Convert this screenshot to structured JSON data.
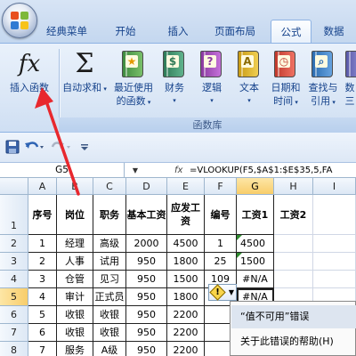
{
  "ribbon": {
    "tabs": [
      {
        "label": "经典菜单",
        "active": false
      },
      {
        "label": "开始",
        "active": false
      },
      {
        "label": "插入",
        "active": false
      },
      {
        "label": "页面布局",
        "active": false
      },
      {
        "label": "公式",
        "active": true
      },
      {
        "label": "数据",
        "active": false
      }
    ],
    "buttons": {
      "insert_function": "插入函数",
      "autosum_line1": "自动求和",
      "recent_line1": "最近使用",
      "recent_line2": "的函数",
      "financial": "财务",
      "logical": "逻辑",
      "text": "文本",
      "datetime_line1": "日期和",
      "datetime_line2": "时间",
      "lookup_line1": "查找与",
      "lookup_line2": "引用",
      "math_line1": "数",
      "math_line2": "三"
    },
    "group_label": "函数库",
    "fx_symbol": "fx",
    "sigma_symbol": "Σ"
  },
  "formula_bar": {
    "name_box": "G5",
    "fx_label": "fx",
    "formula": "=VLOOKUP(F5,$A$1:$E$35,5,FA"
  },
  "sheet": {
    "columns": [
      "A",
      "B",
      "C",
      "D",
      "E",
      "F",
      "G",
      "H",
      "I"
    ],
    "rows": [
      "1",
      "2",
      "3",
      "4",
      "5",
      "6",
      "7",
      "8"
    ],
    "headers": {
      "A": "序号",
      "B": "岗位",
      "C": "职务",
      "D": "基本工资",
      "E": "应发工资",
      "F": "编号",
      "G": "工资1",
      "H": "工资2"
    },
    "data": [
      {
        "A": "1",
        "B": "经理",
        "C": "高级",
        "D": "2000",
        "E": "4500",
        "F": "1",
        "G": "4500"
      },
      {
        "A": "2",
        "B": "人事",
        "C": "试用",
        "D": "950",
        "E": "1800",
        "F": "25",
        "G": "1500"
      },
      {
        "A": "3",
        "B": "仓管",
        "C": "见习",
        "D": "950",
        "E": "1500",
        "F": "109",
        "G": "#N/A"
      },
      {
        "A": "4",
        "B": "审计",
        "C": "正式员",
        "D": "950",
        "E": "1800",
        "F": "",
        "G": "#N/A"
      },
      {
        "A": "5",
        "B": "收银",
        "C": "收银",
        "D": "950",
        "E": "2200",
        "F": "",
        "G": ""
      },
      {
        "A": "6",
        "B": "收银",
        "C": "收银",
        "D": "950",
        "E": "2200",
        "F": "",
        "G": ""
      },
      {
        "A": "7",
        "B": "服务",
        "C": "A级",
        "D": "950",
        "E": "2200",
        "F": "",
        "G": ""
      }
    ]
  },
  "error_menu": {
    "title": "“值不可用”错误",
    "help": "关于此错误的帮助(H)"
  },
  "colors": {
    "accent": "#15428b",
    "arrow": "#e8282e",
    "selection": "#f8cd6a"
  }
}
